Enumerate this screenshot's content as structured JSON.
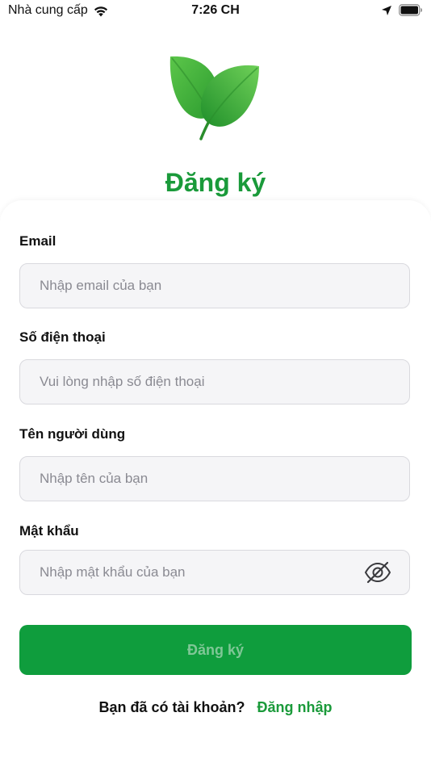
{
  "status_bar": {
    "carrier": "Nhà cung cấp",
    "time": "7:26 CH",
    "icons": [
      "wifi-icon",
      "location-arrow-icon",
      "battery-icon"
    ]
  },
  "header": {
    "logo_icon": "leaves-icon",
    "title": "Đăng ký"
  },
  "form": {
    "email": {
      "label": "Email",
      "placeholder": "Nhập email của bạn",
      "value": ""
    },
    "phone": {
      "label": "Số điện thoại",
      "placeholder": "Vui lòng nhập số điện thoại",
      "value": ""
    },
    "username": {
      "label": "Tên người dùng",
      "placeholder": "Nhập tên của bạn",
      "value": ""
    },
    "password": {
      "label": "Mật khẩu",
      "placeholder": "Nhập mật khẩu của bạn",
      "value": "",
      "toggle_icon": "eye-slash-icon"
    },
    "submit_label": "Đăng ký"
  },
  "footer": {
    "question": "Bạn đã có tài khoản?",
    "login_link": "Đăng nhập"
  },
  "colors": {
    "brand_green": "#1a9a3a",
    "button_green": "#0f9d3d",
    "button_text_disabled": "#7fc796",
    "field_bg": "#f5f5f7",
    "field_border": "#d9d9de"
  }
}
